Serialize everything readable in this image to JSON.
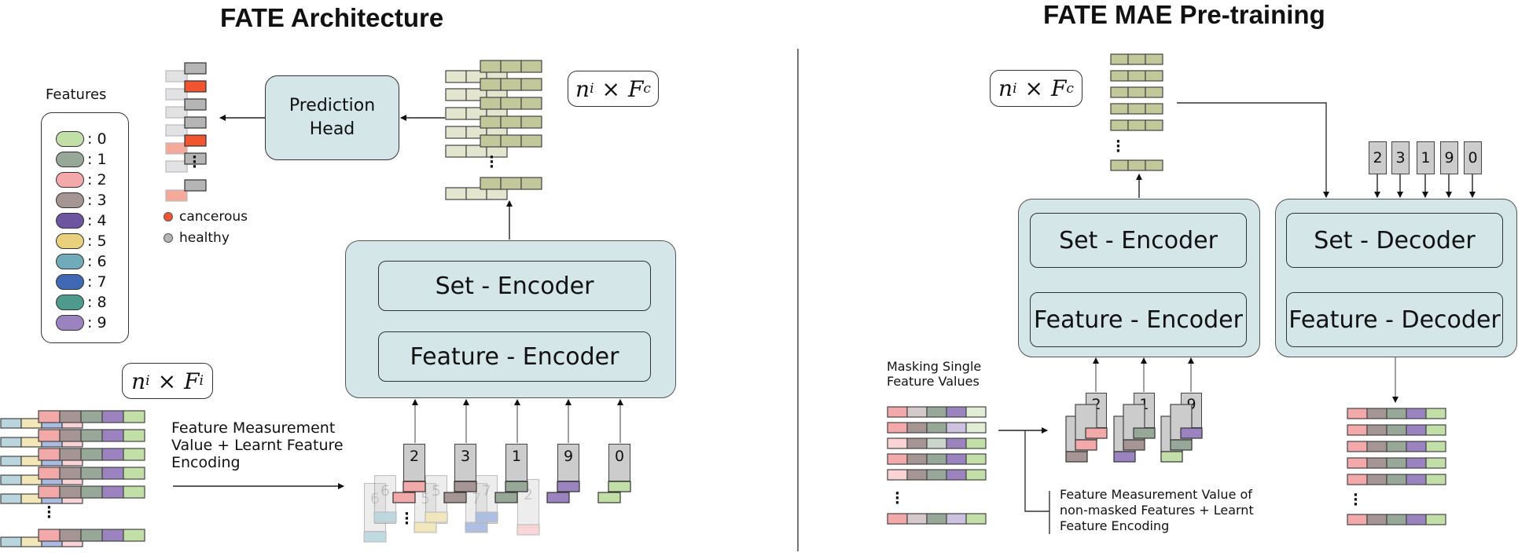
{
  "left_panel": {
    "title": "FATE Architecture",
    "features_title": "Features",
    "features": [
      {
        "label": ": 0",
        "color": "#c2dfa7"
      },
      {
        "label": ": 1",
        "color": "#97a898"
      },
      {
        "label": ": 2",
        "color": "#f3a9aa"
      },
      {
        "label": ": 3",
        "color": "#a69595"
      },
      {
        "label": ": 4",
        "color": "#6e55a0"
      },
      {
        "label": ": 5",
        "color": "#e8d07e"
      },
      {
        "label": ": 6",
        "color": "#71aab8"
      },
      {
        "label": ": 7",
        "color": "#4169b3"
      },
      {
        "label": ": 8",
        "color": "#4f9a8e"
      },
      {
        "label": ": 9",
        "color": "#9b83c0"
      }
    ],
    "prediction_head_line1": "Prediction",
    "prediction_head_line2": "Head",
    "class_legend": [
      {
        "label": "cancerous",
        "color": "#f05430"
      },
      {
        "label": "healthy",
        "color": "#b5b5b5"
      }
    ],
    "output_dims": {
      "n": "n",
      "n_sub": "i",
      "times": "×",
      "F": "F",
      "F_sub": "c"
    },
    "input_dims": {
      "n": "n",
      "n_sub": "i",
      "times": "×",
      "F": "F",
      "F_sub": "i"
    },
    "set_encoder": "Set - Encoder",
    "feature_encoder": "Feature - Encoder",
    "input_caption_line1": "Feature Measurement",
    "input_caption_line2": "Value  + Learnt Feature",
    "input_caption_line3": "Encoding",
    "front_tokens": [
      "2",
      "3",
      "1",
      "9",
      "0"
    ],
    "back_tokens": [
      "6",
      "6",
      "5",
      "5",
      "7",
      "7",
      "2"
    ],
    "predictions": [
      "healthy",
      "cancerous",
      "healthy",
      "healthy",
      "cancerous",
      "healthy"
    ]
  },
  "right_panel": {
    "title": "FATE MAE Pre-training",
    "output_dims": {
      "n": "n",
      "n_sub": "i",
      "times": "×",
      "F": "F",
      "F_sub": "c"
    },
    "set_encoder": "Set - Encoder",
    "feature_encoder": "Feature - Encoder",
    "set_decoder": "Set - Decoder",
    "feature_decoder": "Feature - Decoder",
    "query_tokens": [
      "2",
      "3",
      "1",
      "9",
      "0"
    ],
    "masked_tokens": [
      "2",
      "1",
      "9"
    ],
    "masking_caption_line1": "Masking Single",
    "masking_caption_line2": "Feature Values",
    "nonmasked_caption_line1": "Feature Measurement Value of",
    "nonmasked_caption_line2": "non-masked Features + Learnt",
    "nonmasked_caption_line3": "Feature Encoding"
  },
  "colors": {
    "embedding": "#c3c89b",
    "embedding_faded": "#e3e5cf",
    "box_fill": "#d5e6e8",
    "token_fill": "#cccccc"
  }
}
